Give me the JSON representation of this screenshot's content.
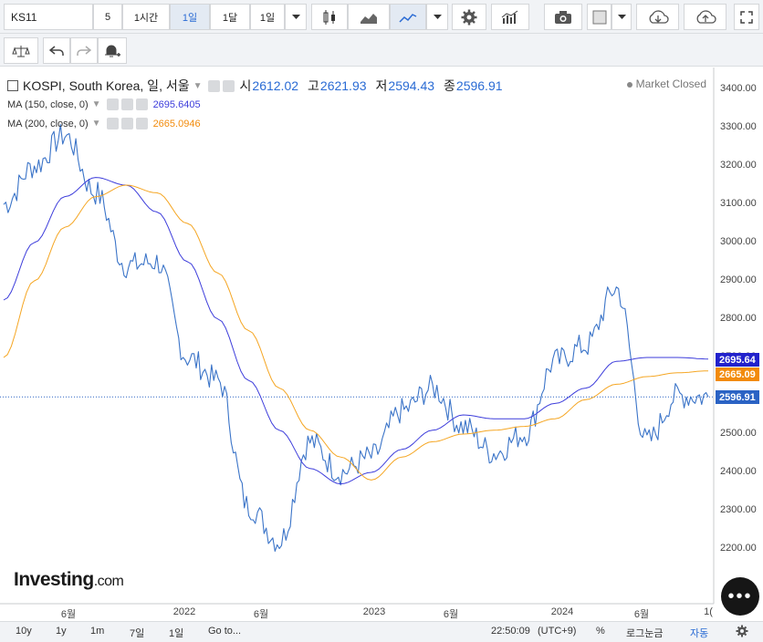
{
  "toolbar": {
    "symbol": "KS11",
    "intervals": [
      "5",
      "1시간",
      "1일",
      "1달",
      "1일"
    ],
    "active_interval": "1일"
  },
  "legend": {
    "title": "KOSPI, South Korea, 일, 서울",
    "o_label": "시",
    "o_value": "2612.02",
    "h_label": "고",
    "h_value": "2621.93",
    "l_label": "저",
    "l_value": "2594.43",
    "c_label": "종",
    "c_value": "2596.91",
    "ma150_label": "MA (150, close, 0)",
    "ma150_value": "2695.6405",
    "ma200_label": "MA (200, close, 0)",
    "ma200_value": "2665.0946",
    "market_status": "Market Closed"
  },
  "y_axis": {
    "labels": [
      "3400.00",
      "3300.00",
      "3200.00",
      "3100.00",
      "3000.00",
      "2900.00",
      "2800.00",
      "2700.00",
      "2600.00",
      "2500.00",
      "2400.00",
      "2300.00",
      "2200.00"
    ],
    "tag_ma150": "2695.64",
    "tag_ma200": "2665.09",
    "tag_close": "2596.91"
  },
  "x_axis": {
    "labels": [
      "6월",
      "2022",
      "6월",
      "2023",
      "6월",
      "2024",
      "6월",
      "1("
    ]
  },
  "bottom_bar": {
    "ranges": [
      "10y",
      "1y",
      "1m",
      "7일",
      "1일"
    ],
    "goto": "Go to...",
    "time": "22:50:09",
    "tz": "(UTC+9)",
    "percent": "%",
    "log": "로그눈금",
    "auto": "자동"
  },
  "branding": {
    "logo": "Investing",
    "logo_suffix": ".com"
  },
  "colors": {
    "price": "#3b74c8",
    "ma150": "#3d3ddb",
    "ma200": "#f5a623",
    "close_tag": "#2b63c4",
    "ma150_tag": "#2222cc",
    "ma200_tag": "#f28b0c"
  },
  "chart_data": {
    "type": "line",
    "x": [
      "2021-03",
      "2021-05",
      "2021-07",
      "2021-09",
      "2021-11",
      "2022-01",
      "2022-03",
      "2022-05",
      "2022-07",
      "2022-09",
      "2022-11",
      "2023-01",
      "2023-03",
      "2023-05",
      "2023-07",
      "2023-09",
      "2023-11",
      "2024-01",
      "2024-03",
      "2024-05",
      "2024-07",
      "2024-08",
      "2024-09",
      "2024-10"
    ],
    "series": [
      {
        "name": "KOSPI",
        "values": [
          3100,
          3200,
          3280,
          3130,
          2940,
          2950,
          2700,
          2640,
          2310,
          2220,
          2480,
          2400,
          2440,
          2560,
          2620,
          2520,
          2450,
          2500,
          2690,
          2730,
          2880,
          2480,
          2600,
          2597
        ]
      },
      {
        "name": "MA (150, close, 0)",
        "values": [
          2850,
          3000,
          3120,
          3170,
          3150,
          3080,
          2950,
          2800,
          2640,
          2510,
          2410,
          2370,
          2400,
          2460,
          2510,
          2550,
          2540,
          2540,
          2580,
          2620,
          2690,
          2700,
          2700,
          2696
        ]
      },
      {
        "name": "MA (200, close, 0)",
        "values": [
          2700,
          2900,
          3040,
          3120,
          3150,
          3130,
          3050,
          2920,
          2770,
          2620,
          2510,
          2440,
          2380,
          2440,
          2480,
          2500,
          2510,
          2520,
          2540,
          2590,
          2630,
          2650,
          2660,
          2665
        ]
      }
    ],
    "ylim": [
      2100,
      3430
    ],
    "grid": false
  }
}
